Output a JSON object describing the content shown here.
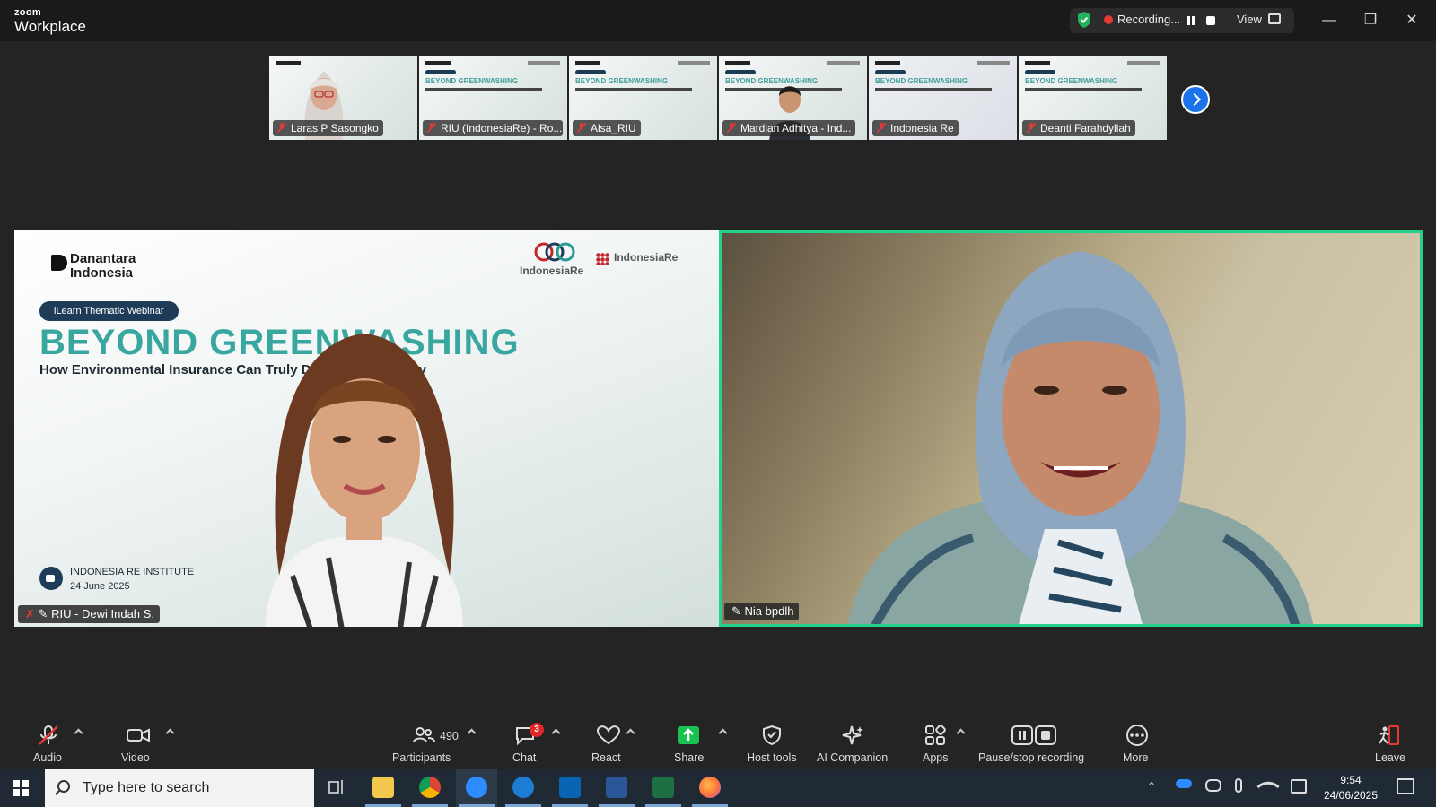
{
  "app": {
    "brand_top": "zoom",
    "brand_bottom": "Workplace"
  },
  "recording": {
    "status": "Recording...",
    "view_label": "View"
  },
  "thumbnails": [
    {
      "name": "Laras P Sasongko",
      "slide_title": "BEYOND GREENWASHING"
    },
    {
      "name": "RIU (IndonesiaRe) - Ro...",
      "slide_title": "BEYOND GREENWASHING"
    },
    {
      "name": "Alsa_RIU",
      "slide_title": "BEYOND GREENWASHING"
    },
    {
      "name": "Mardian Adhitya - Ind...",
      "slide_title": "BEYOND GREENWASHING"
    },
    {
      "name": "Indonesia Re",
      "slide_title": "BEYOND GREENWASHING"
    },
    {
      "name": "Deanti Farahdyllah",
      "slide_title": "BEYOND GREENWASHING"
    }
  ],
  "main_left": {
    "name": "RIU - Dewi Indah S.",
    "slide": {
      "org": "Danantara",
      "org2": "Indonesia",
      "logo1": "IndonesiaRe",
      "logo2": "IndonesiaRe",
      "tag": "iLearn Thematic Webinar",
      "title": "BEYOND GREENWASHING",
      "subtitle": "How Environmental Insurance Can Truly Drive Sustainability",
      "institute": "INDONESIA RE INSTITUTE",
      "date": "24 June 2025"
    }
  },
  "main_right": {
    "name": "Nia bpdlh"
  },
  "toolbar": {
    "audio": "Audio",
    "video": "Video",
    "participants": "Participants",
    "participants_count": "490",
    "chat": "Chat",
    "chat_badge": "3",
    "react": "React",
    "share": "Share",
    "host_tools": "Host tools",
    "ai_companion": "AI Companion",
    "apps": "Apps",
    "pause_stop": "Pause/stop recording",
    "more": "More",
    "leave": "Leave"
  },
  "taskbar": {
    "search_placeholder": "Type here to search",
    "time": "9:54",
    "date": "24/06/2025"
  },
  "colors": {
    "active_speaker": "#23d18b",
    "recording": "#e53935",
    "share": "#19c14e",
    "next": "#1a73e8"
  }
}
